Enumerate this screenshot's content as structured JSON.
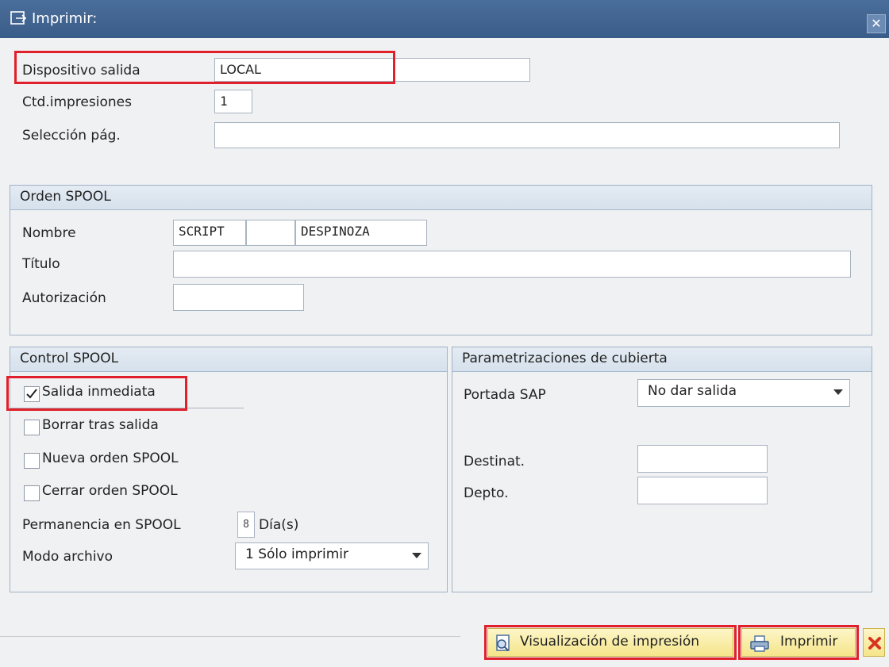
{
  "window": {
    "title": "Imprimir:",
    "close_symbol": "✕"
  },
  "top": {
    "dispositivo_label": "Dispositivo salida",
    "dispositivo_value": "LOCAL",
    "ctd_label": "Ctd.impresiones",
    "ctd_value": "1",
    "seleccion_label": "Selección pág.",
    "seleccion_value": ""
  },
  "orden": {
    "header": "Orden SPOOL",
    "nombre_label": "Nombre",
    "nombre_1": "SCRIPT",
    "nombre_2": "",
    "nombre_3": "DESPINOZA",
    "titulo_label": "Título",
    "titulo_value": "",
    "autorizacion_label": "Autorización",
    "autorizacion_value": ""
  },
  "control": {
    "header": "Control SPOOL",
    "items": [
      {
        "label": "Salida inmediata",
        "checked": true
      },
      {
        "label": "Borrar tras salida",
        "checked": false
      },
      {
        "label": "Nueva orden SPOOL",
        "checked": false
      },
      {
        "label": "Cerrar orden SPOOL",
        "checked": false
      }
    ],
    "permanencia_label": "Permanencia en SPOOL",
    "permanencia_value": "8",
    "permanencia_unit": "Día(s)",
    "modo_label": "Modo archivo",
    "modo_value": "1 Sólo imprimir"
  },
  "cubierta": {
    "header": "Parametrizaciones de cubierta",
    "portada_label": "Portada SAP",
    "portada_value": "No dar salida",
    "destinat_label": "Destinat.",
    "destinat_value": "",
    "depto_label": "Depto.",
    "depto_value": ""
  },
  "buttons": {
    "preview": "Visualización de impresión",
    "print": "Imprimir"
  },
  "colors": {
    "highlight": "#e0212b",
    "titlebar": "#3f6290",
    "button_bg": "#f7e98f"
  }
}
